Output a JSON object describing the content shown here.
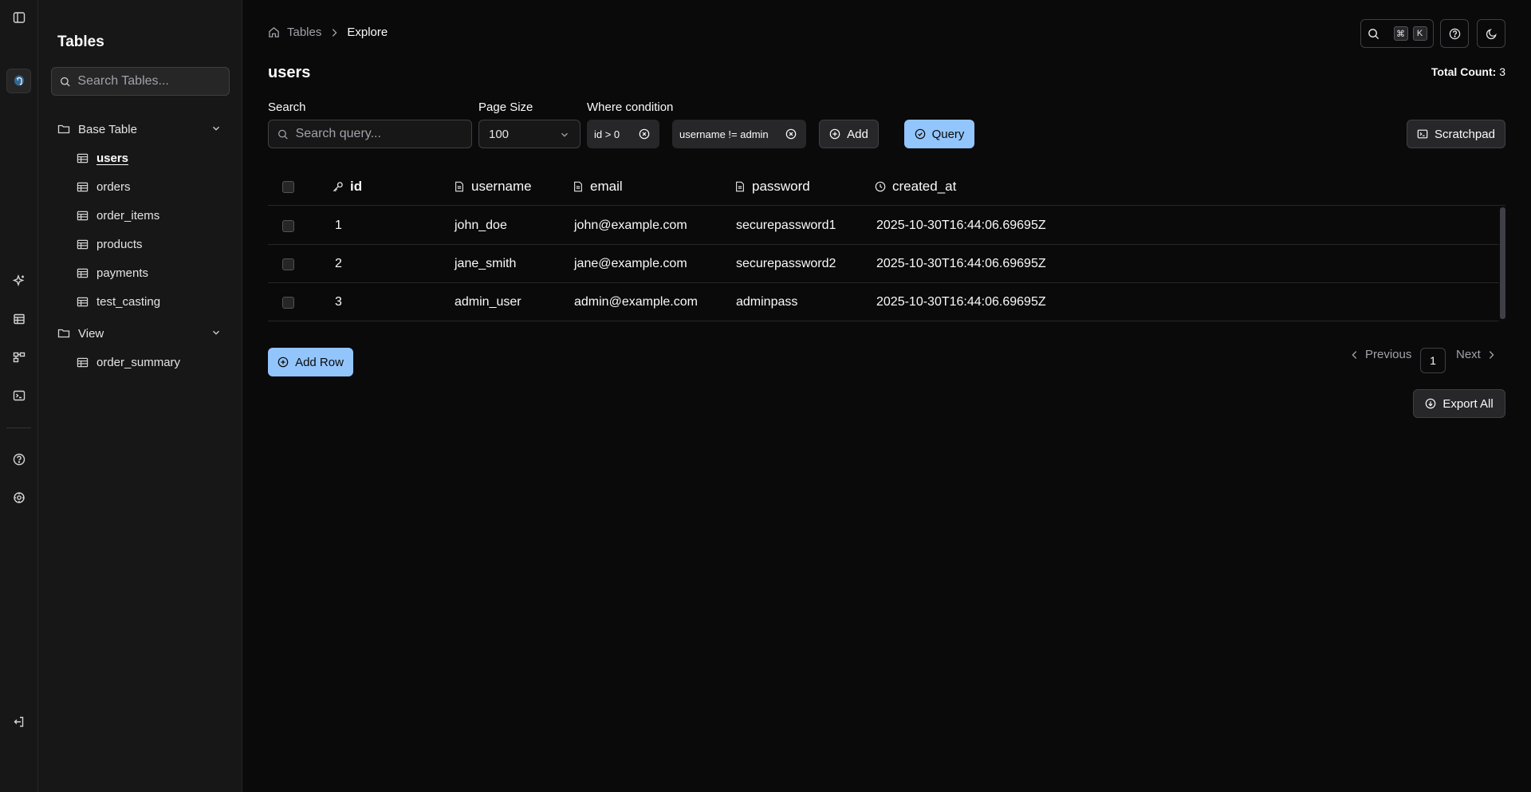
{
  "sidebar": {
    "title": "Tables",
    "search_placeholder": "Search Tables...",
    "groups": [
      {
        "label": "Base Table",
        "items": [
          {
            "label": "users",
            "active": true
          },
          {
            "label": "orders"
          },
          {
            "label": "order_items"
          },
          {
            "label": "products"
          },
          {
            "label": "payments"
          },
          {
            "label": "test_casting"
          }
        ]
      },
      {
        "label": "View",
        "items": [
          {
            "label": "order_summary"
          }
        ]
      }
    ]
  },
  "breadcrumb": {
    "root": "Tables",
    "current": "Explore"
  },
  "header": {
    "kbd_cmd": "⌘",
    "kbd_key": "K"
  },
  "page": {
    "title": "users",
    "total_count_label": "Total Count:",
    "total_count_value": "3"
  },
  "filters": {
    "search_label": "Search",
    "search_placeholder": "Search query...",
    "page_size_label": "Page Size",
    "page_size_value": "100",
    "where_label": "Where condition",
    "conditions": [
      "id > 0",
      "username != admin"
    ],
    "add_label": "Add",
    "query_label": "Query",
    "scratchpad_label": "Scratchpad"
  },
  "table": {
    "columns": [
      "id",
      "username",
      "email",
      "password",
      "created_at"
    ],
    "rows": [
      [
        "1",
        "john_doe",
        "john@example.com",
        "securepassword1",
        "2025-10-30T16:44:06.69695Z"
      ],
      [
        "2",
        "jane_smith",
        "jane@example.com",
        "securepassword2",
        "2025-10-30T16:44:06.69695Z"
      ],
      [
        "3",
        "admin_user",
        "admin@example.com",
        "adminpass",
        "2025-10-30T16:44:06.69695Z"
      ]
    ]
  },
  "actions": {
    "add_row_label": "Add Row",
    "previous_label": "Previous",
    "next_label": "Next",
    "current_page": "1",
    "export_label": "Export All"
  },
  "colors": {
    "accent": "#93c5fd",
    "background": "#0a0a0a",
    "sidebar": "#171717"
  }
}
